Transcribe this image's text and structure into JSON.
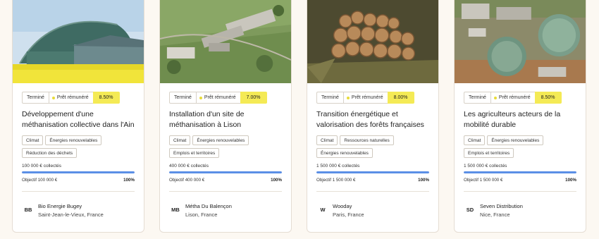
{
  "colors": {
    "page_bg": "#fcf8f2",
    "rate_badge": "#f4ea55",
    "status_dot": "#e8dc3a",
    "progress": "#5b8fe6"
  },
  "cards": [
    {
      "image": "biogas-dome-rapeseed-field",
      "status": "Terminé",
      "loan_type": "Prêt rémunéré",
      "rate": "8.50%",
      "title": "Développement d'une méthanisation collective dans l'Ain",
      "tags": [
        "Climat",
        "Énergies renouvelables",
        "Réduction des déchets"
      ],
      "collected": "100 000 € collectés",
      "progress": 1.0,
      "goal": "Objectif 100 000 €",
      "percent": "100%",
      "org_initials": "BB",
      "org_name": "Bio Energie Bugey",
      "org_location": "Saint-Jean-le-Vieux, France"
    },
    {
      "image": "aerial-farm-site",
      "status": "Terminé",
      "loan_type": "Prêt rémunéré",
      "rate": "7.00%",
      "title": "Installation d'un site de méthanisation à Lison",
      "tags": [
        "Climat",
        "Énergies renouvelables",
        "Emplois et territoires"
      ],
      "collected": "400 000 € collectés",
      "progress": 1.0,
      "goal": "Objectif 400 000 €",
      "percent": "100%",
      "org_initials": "MB",
      "org_name": "Métha Du Balençon",
      "org_location": "Lison, France"
    },
    {
      "image": "stacked-logs",
      "status": "Terminé",
      "loan_type": "Prêt rémunéré",
      "rate": "8.00%",
      "title": "Transition énergétique et valorisation des forêts françaises",
      "tags": [
        "Climat",
        "Ressources naturelles",
        "Énergies renouvelables"
      ],
      "collected": "1 500 000 € collectés",
      "progress": 1.0,
      "goal": "Objectif 1 500 000 €",
      "percent": "100%",
      "org_initials": "W",
      "org_name": "Wooday",
      "org_location": "Paris, France"
    },
    {
      "image": "aerial-biogas-tanks",
      "status": "Terminé",
      "loan_type": "Prêt rémunéré",
      "rate": "8.50%",
      "title": "Les agriculteurs acteurs de la mobilité durable",
      "tags": [
        "Climat",
        "Énergies renouvelables",
        "Emplois et territoires"
      ],
      "collected": "1 500 000 € collectés",
      "progress": 1.0,
      "goal": "Objectif 1 500 000 €",
      "percent": "100%",
      "org_initials": "SD",
      "org_name": "Seven Distribution",
      "org_location": "Nice, France"
    }
  ]
}
